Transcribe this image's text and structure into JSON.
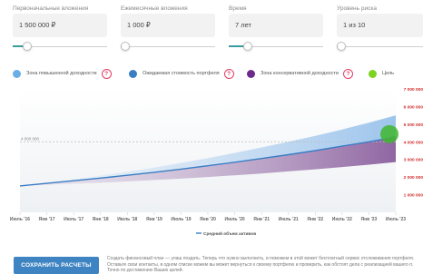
{
  "inputs": [
    {
      "label": "Первоначальные вложения",
      "value": "1 500 000 ₽",
      "fraction": 0.15
    },
    {
      "label": "Ежемесячные вложения",
      "value": "1 000 ₽",
      "fraction": 0.0
    },
    {
      "label": "Время",
      "value": "7 лет",
      "fraction": 0.2
    },
    {
      "label": "Уровень риска",
      "value": "1 из 10",
      "fraction": 0.0
    }
  ],
  "legend": [
    {
      "label": "Зона повышенной доходности",
      "color": "#6aaee6",
      "help_icon": "?"
    },
    {
      "label": "Ожидаемая стоимость портфеля",
      "color": "#3a7dc4",
      "help_icon": "?"
    },
    {
      "label": "Зона консервативной доходности",
      "color": "#6b2a8c",
      "help_icon": "?"
    },
    {
      "label": "Цель",
      "color": "#7ed321"
    }
  ],
  "chart_data": {
    "type": "area",
    "x": [
      "Июль '16",
      "Янв '17",
      "Июль '17",
      "Янв '18",
      "Июль '18",
      "Янв '19",
      "Июль '19",
      "Янв '20",
      "Июль '20",
      "Янв '21",
      "Июль '21",
      "Янв '22",
      "Июль '22",
      "Янв '23",
      "Июль '23"
    ],
    "series": [
      {
        "name": "Средний объем активов",
        "values": [
          1500000,
          1640000,
          1790000,
          1940000,
          2100000,
          2270000,
          2450000,
          2640000,
          2840000,
          3050000,
          3270000,
          3500000,
          3750000,
          4000000,
          4280000
        ],
        "color": "#3a7dc4"
      },
      {
        "values": [
          1500000,
          1680000,
          1870000,
          2080000,
          2300000,
          2540000,
          2800000,
          3070000,
          3370000,
          3680000,
          4000000,
          4340000,
          4700000,
          5080000,
          5500000
        ],
        "color": "#9cc6ef"
      },
      {
        "values": [
          1500000,
          1560000,
          1620000,
          1680000,
          1750000,
          1830000,
          1910000,
          2000000,
          2100000,
          2200000,
          2320000,
          2440000,
          2570000,
          2700000,
          2850000
        ],
        "color": "#6b2a8c"
      }
    ],
    "yticks": [
      "7 000 000",
      "6 000 000",
      "5 000 000",
      "4 000 000",
      "3 000 000",
      "2 000 000",
      "1 000 000"
    ],
    "ylim": [
      0,
      7000000
    ],
    "target_line_label": "4 000 000",
    "target_value": 4000000,
    "legend": "Средний объем активов"
  },
  "save_button": "СОХРАНИТЬ РАСЧЕТЫ",
  "disclaimer": "Создать финансовый план — улаш поздать. Теперь что нужно выполнить, и поможем в этой может бесплатный сервис отслеживания портфеля. Оставьте свои контакты, в одном списке можем вы может вернуться к своему портфелю и проверить, как обстоят дела с реализацией вашего п. Точно по достижению Ваших целей."
}
